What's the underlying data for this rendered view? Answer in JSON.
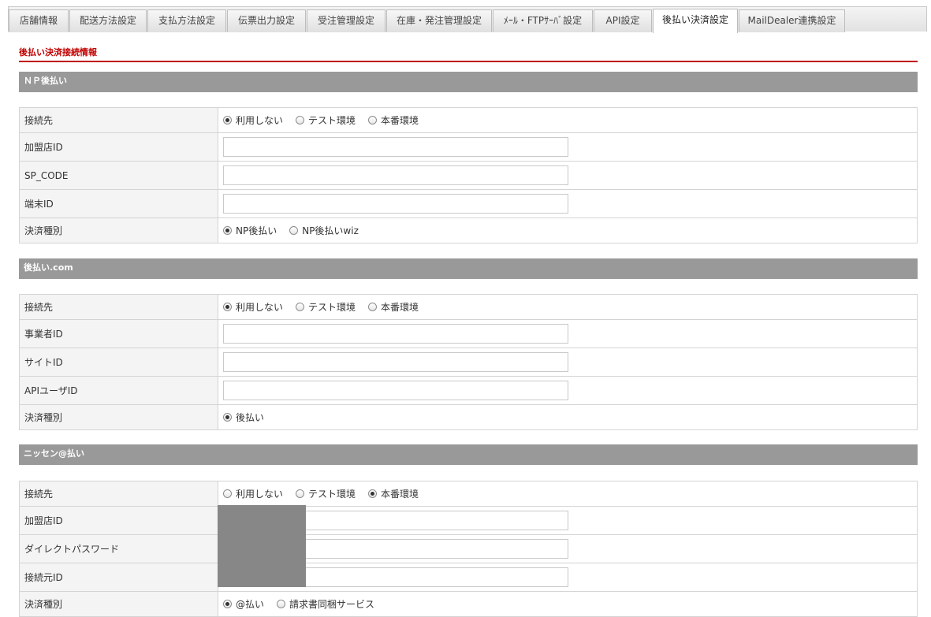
{
  "tabs": [
    {
      "label": "店舗情報"
    },
    {
      "label": "配送方法設定"
    },
    {
      "label": "支払方法設定"
    },
    {
      "label": "伝票出力設定"
    },
    {
      "label": "受注管理設定"
    },
    {
      "label": "在庫・発注管理設定"
    },
    {
      "label": "ﾒｰﾙ・FTPｻｰﾊﾞ設定"
    },
    {
      "label": "API設定"
    },
    {
      "label": "後払い決済設定"
    },
    {
      "label": "MailDealer連携設定"
    }
  ],
  "active_tab": "後払い決済設定",
  "page_title": "後払い決済接続情報",
  "groups": [
    {
      "title": "ＮＰ後払い",
      "rows": [
        {
          "label": "接続先",
          "type": "radio",
          "options": [
            "利用しない",
            "テスト環境",
            "本番環境"
          ],
          "selected": 0
        },
        {
          "label": "加盟店ID",
          "type": "text",
          "value": ""
        },
        {
          "label": "SP_CODE",
          "type": "text",
          "value": ""
        },
        {
          "label": "端末ID",
          "type": "text",
          "value": ""
        },
        {
          "label": "決済種別",
          "type": "radio",
          "options": [
            "NP後払い",
            "NP後払いwiz"
          ],
          "selected": 0
        }
      ]
    },
    {
      "title": "後払い.com",
      "rows": [
        {
          "label": "接続先",
          "type": "radio",
          "options": [
            "利用しない",
            "テスト環境",
            "本番環境"
          ],
          "selected": 0
        },
        {
          "label": "事業者ID",
          "type": "text",
          "value": ""
        },
        {
          "label": "サイトID",
          "type": "text",
          "value": ""
        },
        {
          "label": "APIユーザID",
          "type": "text",
          "value": ""
        },
        {
          "label": "決済種別",
          "type": "radio",
          "options": [
            "後払い"
          ],
          "selected": 0
        }
      ]
    },
    {
      "title": "ニッセン@払い",
      "rows": [
        {
          "label": "接続先",
          "type": "radio",
          "options": [
            "利用しない",
            "テスト環境",
            "本番環境"
          ],
          "selected": 2
        },
        {
          "label": "加盟店ID",
          "type": "text",
          "value": ""
        },
        {
          "label": "ダイレクトパスワード",
          "type": "text",
          "value": ""
        },
        {
          "label": "接続元ID",
          "type": "text",
          "value": ""
        },
        {
          "label": "決済種別",
          "type": "radio",
          "options": [
            "@払い",
            "請求書同梱サービス"
          ],
          "selected": 0
        }
      ]
    }
  ]
}
